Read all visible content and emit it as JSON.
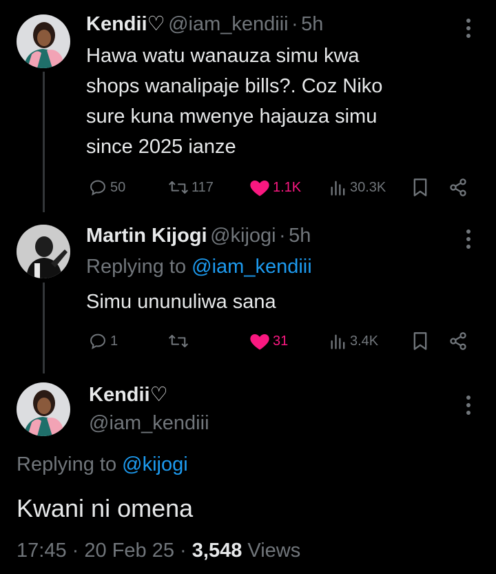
{
  "tweet1": {
    "name": "Kendii♡",
    "handle": "@iam_kendiii",
    "sep": "·",
    "time": "5h",
    "lines": [
      "Hawa watu wanauza simu kwa",
      "shops wanalipaje bills?. Coz Niko",
      "sure kuna mwenye hajauza simu",
      "since 2025 ianze"
    ],
    "replies": "50",
    "retweets": "117",
    "likes": "1.1K",
    "views": "30.3K"
  },
  "tweet2": {
    "name": "Martin Kijogi",
    "handle": "@kijogi",
    "sep": "·",
    "time": "5h",
    "replying_label": "Replying to",
    "replying_handle": "@iam_kendiii",
    "text": "Simu ununuliwa sana",
    "replies": "1",
    "retweets": "",
    "likes": "31",
    "views": "3.4K"
  },
  "main": {
    "name": "Kendii♡",
    "handle": "@iam_kendiii",
    "replying_label": "Replying to",
    "replying_handle": "@kijogi",
    "text": "Kwani ni omena",
    "time": "17:45",
    "date": "20 Feb 25",
    "sep": "·",
    "views_count": "3,548",
    "views_label": "Views"
  },
  "colors": {
    "background": "#000000",
    "text": "#e7e9ea",
    "muted": "#71767b",
    "link": "#1d9bf0",
    "like": "#f91880"
  }
}
